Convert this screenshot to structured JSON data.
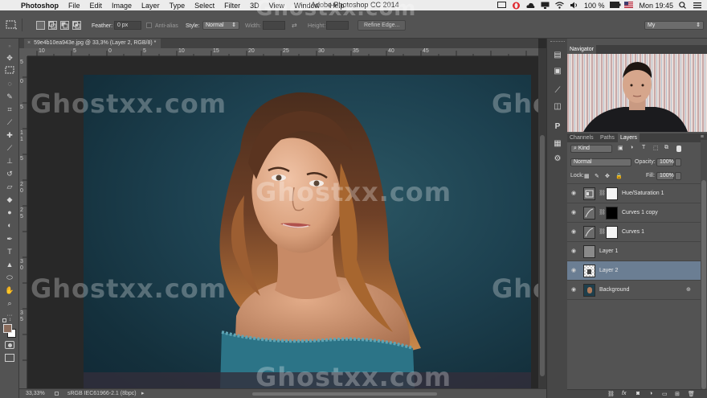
{
  "menubar": {
    "app_name": "Photoshop",
    "items": [
      "File",
      "Edit",
      "Image",
      "Layer",
      "Type",
      "Select",
      "Filter",
      "3D",
      "View",
      "Window",
      "Help"
    ],
    "window_title": "Adobe Photoshop CC 2014",
    "battery": "100 %",
    "clock": "Mon 19:45"
  },
  "options_bar": {
    "feather_label": "Feather:",
    "feather_value": "0 px",
    "antialias_label": "Anti-alias",
    "style_label": "Style:",
    "style_value": "Normal",
    "width_label": "Width:",
    "height_label": "Height:",
    "refine_edge_label": "Refine Edge...",
    "workspace_value": "My"
  },
  "document": {
    "tab_title": "59e4b10ea943e.jpg @ 33,3% (Layer 2, RGB/8) *",
    "ruler_top": [
      "10",
      "5",
      "0",
      "5",
      "10",
      "15",
      "20",
      "25",
      "30",
      "35",
      "40",
      "45"
    ],
    "ruler_left": [
      "5",
      "0",
      "5",
      "1",
      "1",
      "5",
      "2",
      "0",
      "2",
      "5",
      "3",
      "0",
      "3",
      "5"
    ]
  },
  "status": {
    "zoom": "33,33%",
    "profile": "sRGB IEC61966-2.1 (8bpc)"
  },
  "navigator": {
    "title": "Navigator"
  },
  "layers_panel": {
    "tabs": [
      "Channels",
      "Paths",
      "Layers"
    ],
    "filter_kind": "Kind",
    "blend_mode": "Normal",
    "opacity_label": "Opacity:",
    "opacity_value": "100%",
    "lock_label": "Lock:",
    "fill_label": "Fill:",
    "fill_value": "100%",
    "layers": [
      {
        "name": "Hue/Saturation 1"
      },
      {
        "name": "Curves 1 copy"
      },
      {
        "name": "Curves 1"
      },
      {
        "name": "Layer 1"
      },
      {
        "name": "Layer 2"
      },
      {
        "name": "Background"
      }
    ]
  },
  "watermark": "Ghostxx.com"
}
